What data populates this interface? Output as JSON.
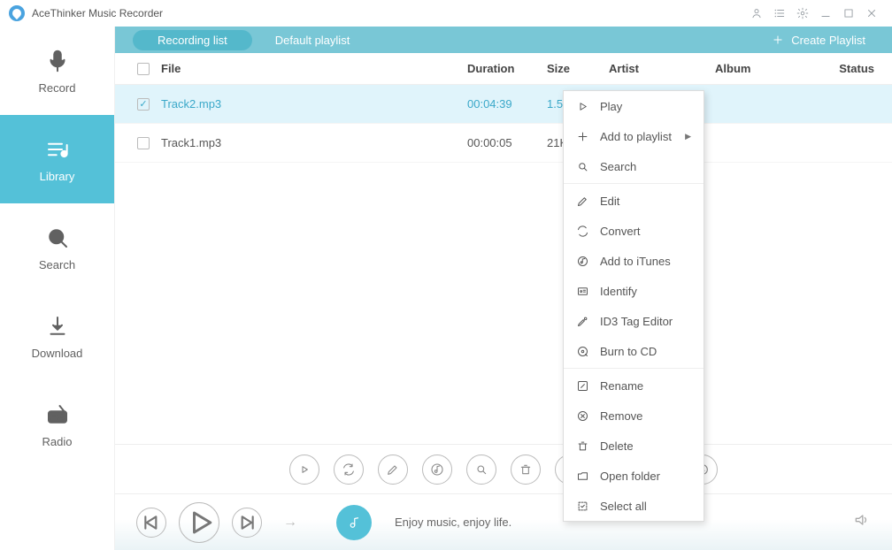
{
  "app": {
    "title": "AceThinker Music Recorder"
  },
  "sidebar": {
    "items": [
      {
        "label": "Record"
      },
      {
        "label": "Library"
      },
      {
        "label": "Search"
      },
      {
        "label": "Download"
      },
      {
        "label": "Radio"
      }
    ]
  },
  "tabs": {
    "active": "Recording list",
    "other": "Default playlist",
    "create": "Create Playlist"
  },
  "columns": {
    "file": "File",
    "duration": "Duration",
    "size": "Size",
    "artist": "Artist",
    "album": "Album",
    "status": "Status"
  },
  "tracks": [
    {
      "file": "Track2.mp3",
      "duration": "00:04:39",
      "size": "1.51MB",
      "selected": true
    },
    {
      "file": "Track1.mp3",
      "duration": "00:00:05",
      "size": "21KB",
      "selected": false
    }
  ],
  "context_menu": {
    "items": [
      "Play",
      "Add to playlist",
      "Search",
      "Edit",
      "Convert",
      "Add to iTunes",
      "Identify",
      "ID3 Tag Editor",
      "Burn to CD",
      "Rename",
      "Remove",
      "Delete",
      "Open folder",
      "Select all"
    ]
  },
  "player": {
    "tagline": "Enjoy music, enjoy life."
  }
}
